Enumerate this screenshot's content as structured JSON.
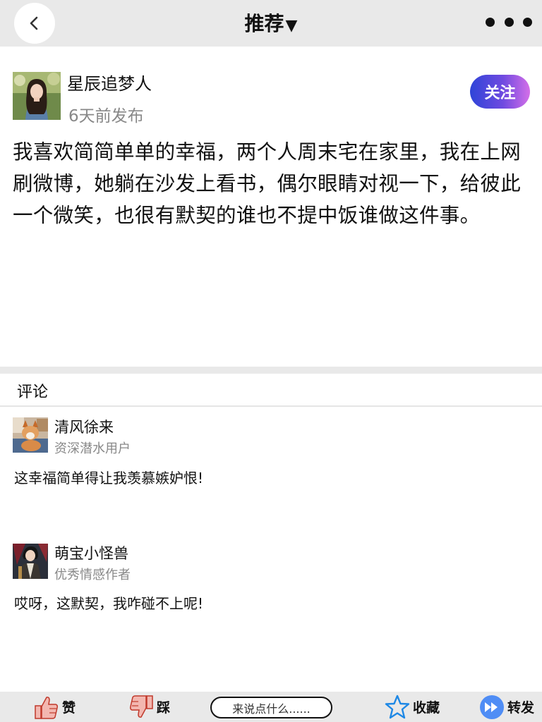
{
  "nav": {
    "title": "推荐",
    "caret": "▼"
  },
  "post": {
    "author_name": "星辰追梦人",
    "time": "6天前发布",
    "follow_label": "关注",
    "body": "我喜欢简简单单的幸福，两个人周末宅在家里，我在上网刷微博，她躺在沙发上看书，偶尔眼睛对视一下，给彼此一个微笑，也很有默契的谁也不提中饭谁做这件事。"
  },
  "comments": {
    "header": "评论",
    "items": [
      {
        "name": "清风徐来",
        "tag": "资深潜水用户",
        "text": "这幸福简单得让我羡慕嫉妒恨!"
      },
      {
        "name": "萌宝小怪兽",
        "tag": "优秀情感作者",
        "text": "哎呀，这默契，我咋碰不上呢!"
      }
    ]
  },
  "bottom": {
    "like_label": "赞",
    "dislike_label": "踩",
    "input_placeholder": "来说点什么......",
    "favorite_label": "收藏",
    "share_label": "转发"
  },
  "colors": {
    "bar_bg": "#e9e9e9",
    "follow_gradient_start": "#2f45d8",
    "follow_gradient_end": "#d46fe8",
    "muted_text": "#888888",
    "star_blue": "#1e88e5",
    "share_blue": "#4f8df5",
    "thumb_pink": "#f3b7b0"
  },
  "icons": {
    "back": "chevron-left-icon",
    "more": "more-dots-icon",
    "like": "thumbs-up-icon",
    "dislike": "thumbs-down-icon",
    "favorite": "star-icon",
    "share": "fast-forward-icon"
  }
}
